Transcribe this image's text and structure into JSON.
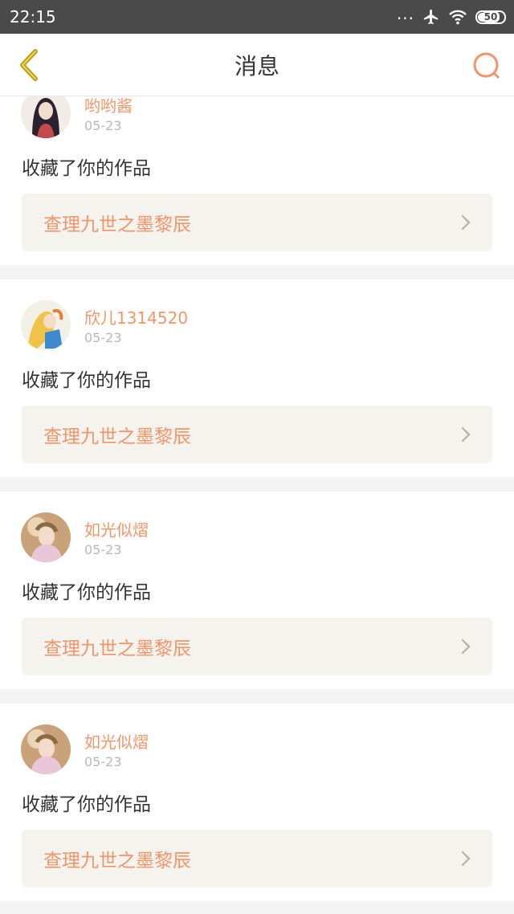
{
  "status_bar": {
    "time": "22:15",
    "dots": "...",
    "battery": "50",
    "icons": [
      "more-dots-icon",
      "airplane-mode-icon",
      "wifi-icon",
      "battery-icon"
    ]
  },
  "header": {
    "title": "消息",
    "back_icon": "back-chevron-icon",
    "search_icon": "search-icon"
  },
  "colors": {
    "accent": "#f0956a",
    "back_icon": "#b8a020",
    "text": "#333333",
    "muted": "#b8b8b8",
    "link_bg": "#f4f3ee"
  },
  "messages": [
    {
      "username": "哟哟酱",
      "date": "05-23",
      "action": "收藏了你的作品",
      "work_title": "查理九世之墨黎辰"
    },
    {
      "username": "欣儿1314520",
      "date": "05-23",
      "action": "收藏了你的作品",
      "work_title": "查理九世之墨黎辰"
    },
    {
      "username": "如光似熠",
      "date": "05-23",
      "action": "收藏了你的作品",
      "work_title": "查理九世之墨黎辰"
    },
    {
      "username": "如光似熠",
      "date": "05-23",
      "action": "收藏了你的作品",
      "work_title": "查理九世之墨黎辰"
    }
  ]
}
